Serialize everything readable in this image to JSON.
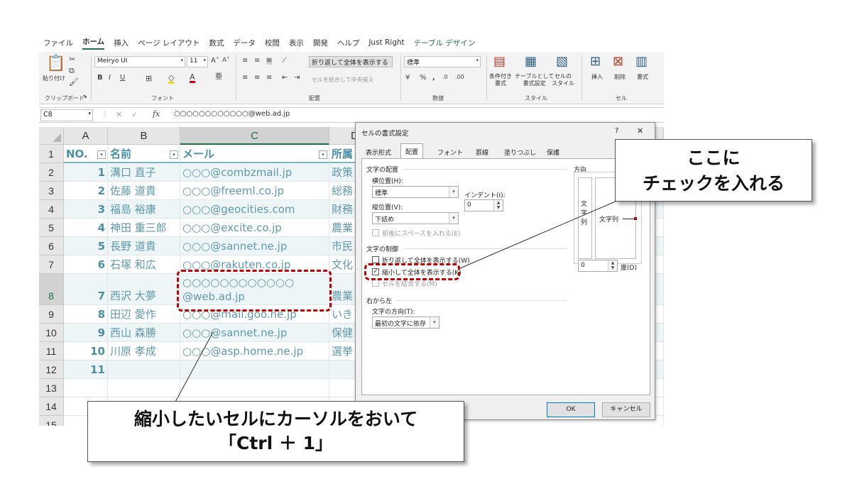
{
  "menu": [
    "ファイル",
    "ホーム",
    "挿入",
    "ページ レイアウト",
    "数式",
    "データ",
    "校閲",
    "表示",
    "開発",
    "ヘルプ",
    "Just Right",
    "テーブル デザイン"
  ],
  "ribbon": {
    "paste_label": "貼り付け",
    "clipboard_group": "クリップボード",
    "font_name": "Meiryo UI",
    "font_size": "11",
    "font_group": "フォント",
    "wrap_text": "折り返して全体を表示する",
    "merge_center": "セルを結合して中央揃え",
    "align_group": "配置",
    "number_format": "標準",
    "number_group": "数値",
    "cond_format": "条件付き\n書式",
    "table_format": "テーブルとして\n書式設定",
    "cell_styles": "セルの\nスタイル",
    "styles_group": "スタイル",
    "insert": "挿入",
    "delete": "削除",
    "format": "書式",
    "cells_group": "セル"
  },
  "formula_bar": {
    "name_box": "C8",
    "fx": "fx",
    "content": "○○○○○○○○○○○○@web.ad.jp"
  },
  "columns": [
    "A",
    "B",
    "C",
    "D"
  ],
  "headers": {
    "no": "NO.",
    "name": "名前",
    "mail": "メール",
    "dept": "所属"
  },
  "rows": [
    {
      "row": "1"
    },
    {
      "row": "2",
      "no": "1",
      "name": "溝口 直子",
      "mail": "○○○@combzmail.jp",
      "dept": "政策"
    },
    {
      "row": "3",
      "no": "2",
      "name": "佐藤 道貴",
      "mail": "○○○@freeml.co.jp",
      "dept": "総務"
    },
    {
      "row": "4",
      "no": "3",
      "name": "福島 裕康",
      "mail": "○○○@geocities.com",
      "dept": "財務"
    },
    {
      "row": "5",
      "no": "4",
      "name": "神田 重三郎",
      "mail": "○○○@excite.co.jp",
      "dept": "農業"
    },
    {
      "row": "6",
      "no": "5",
      "name": "長野 道貴",
      "mail": "○○○@sannet.ne.jp",
      "dept": "市民"
    },
    {
      "row": "7",
      "no": "6",
      "name": "石塚 和広",
      "mail": "○○○@rakuten.co.jp",
      "dept": "文化"
    },
    {
      "row": "8",
      "no": "7",
      "name": "西沢 大夢",
      "mail": "○○○○○○○○○○○○",
      "mail2": "@web.ad.jp",
      "dept": "農業"
    },
    {
      "row": "9",
      "no": "8",
      "name": "田辺 愛作",
      "mail": "○○○@mail.goo.ne.jp",
      "dept": "いきし"
    },
    {
      "row": "10",
      "no": "9",
      "name": "西山 森勝",
      "mail": "○○○@sannet.ne.jp",
      "dept": "保健"
    },
    {
      "row": "11",
      "no": "10",
      "name": "川原 孝成",
      "mail": "○○○@asp.home.ne.jp",
      "dept": "選挙"
    },
    {
      "row": "12",
      "no": "11"
    },
    {
      "row": "13"
    },
    {
      "row": "14"
    },
    {
      "row": "15"
    }
  ],
  "dialog": {
    "title": "セルの書式設定",
    "help": "?",
    "close": "✕",
    "tabs": [
      "表示形式",
      "配置",
      "フォント",
      "罫線",
      "塗りつぶし",
      "保護"
    ],
    "text_alignment": "文字の配置",
    "horizontal": "横位置(H):",
    "horizontal_value": "標準",
    "indent": "インデント(I):",
    "indent_value": "0",
    "vertical": "縦位置(V):",
    "vertical_value": "下詰め",
    "justify_distributed": "前後にスペースを入れる(E)",
    "text_control": "文字の制御",
    "wrap": "折り返して全体を表示する(W)",
    "shrink": "縮小して全体を表示する(K)",
    "merge": "セルを結合する(M)",
    "rtl": "右から左",
    "text_direction": "文字の方向(T):",
    "text_direction_value": "最初の文字に依存",
    "orientation": "方向",
    "vertical_text": "文\n字\n列",
    "orient_text": "文字列",
    "degrees_value": "0",
    "degrees": "度(D)",
    "ok": "OK",
    "cancel": "キャンセル"
  },
  "callouts": {
    "check": "ここに\nチェックを入れる",
    "instruction": "縮小したいセルにカーソルをおいて\n「Ctrl ＋ 1」"
  }
}
